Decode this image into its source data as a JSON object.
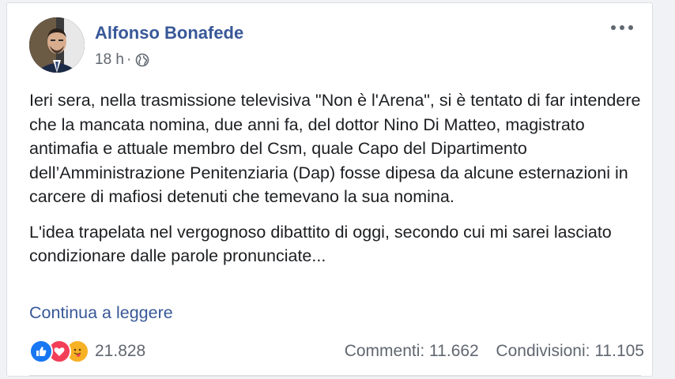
{
  "post": {
    "author": "Alfonso Bonafede",
    "time": "18 h",
    "separator": "·",
    "audience_icon": "globe-icon",
    "more_icon": "more-options-icon",
    "paragraphs": [
      "Ieri sera, nella trasmissione televisiva \"Non è l'Arena\", si è tentato di far intendere che la mancata nomina, due anni fa, del dottor Nino Di Matteo, magistrato antimafia e attuale membro del Csm, quale Capo del Dipartimento dell’Amministrazione Penitenziaria (Dap) fosse dipesa da alcune esternazioni in carcere di mafiosi detenuti che temevano la sua nomina.",
      "L'idea trapelata nel vergognoso dibattito di oggi, secondo cui mi sarei lasciato condizionare dalle parole pronunciate..."
    ],
    "continue_label": "Continua a leggere"
  },
  "footer": {
    "reaction_icons": [
      "like-icon",
      "love-icon",
      "care-icon"
    ],
    "reaction_count": "21.828",
    "comments": "Commenti: 11.662",
    "shares": "Condivisioni: 11.105"
  },
  "colors": {
    "link": "#385898",
    "text": "#1c1e21",
    "secondary": "#606770",
    "like": "#1877f2",
    "love": "#f33e58",
    "care": "#f7b125"
  }
}
